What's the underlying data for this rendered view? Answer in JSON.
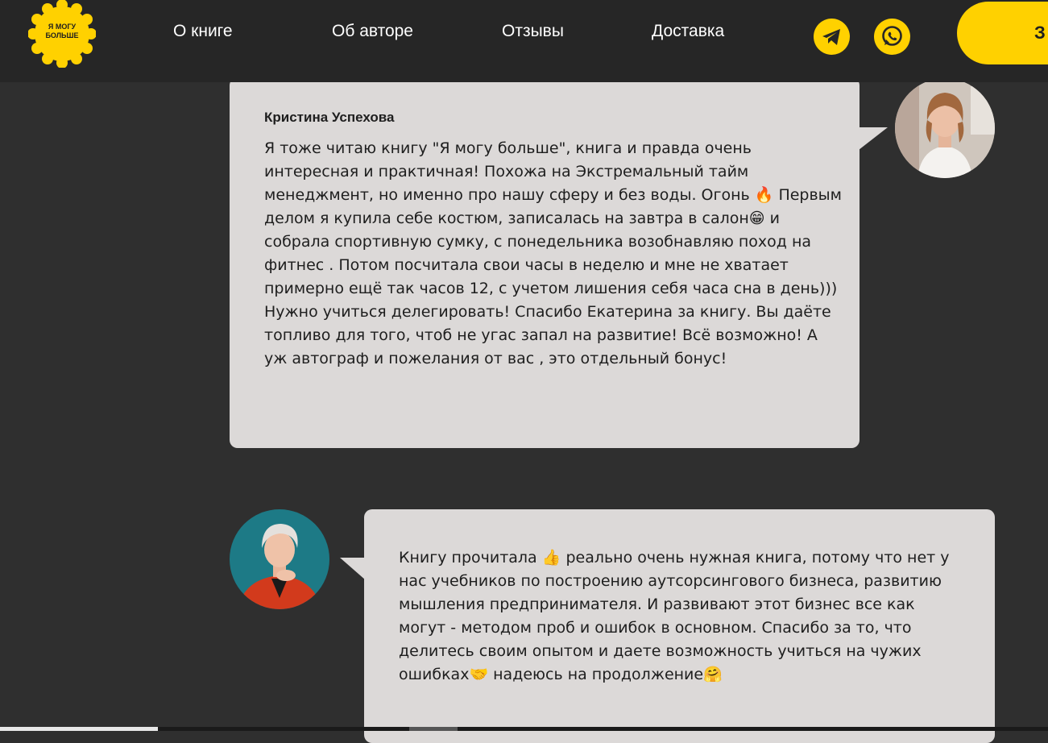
{
  "header": {
    "logo_text": "Я МОГУ\nБОЛЬШЕ",
    "nav": [
      {
        "label": "О книге"
      },
      {
        "label": "Об авторе"
      },
      {
        "label": "Отзывы"
      },
      {
        "label": "Доставка"
      }
    ],
    "social": [
      {
        "icon": "telegram-icon"
      },
      {
        "icon": "whatsapp-icon"
      }
    ],
    "order_button_label": "З"
  },
  "reviews": [
    {
      "author": "Кристина Успехова",
      "text": "Я тоже читаю книгу \"Я могу больше\", книга и правда очень интересная и практичная! Похожа на Экстремальный тайм менеджмент, но именно про нашу сферу и без воды. Огонь 🔥 Первым делом я купила себе костюм, записалась на завтра в салон😁 и собрала спортивную сумку, с понедельника возобнавляю поход на фитнес . Потом посчитала свои часы в неделю и мне не хватает примерно ещё так часов 12, с учетом лишения себя часа сна в день))) Нужно учиться делегировать! Спасибо Екатерина за книгу. Вы даёте топливо для того, чтоб не угас запал на развитие! Всё возможно! А уж автограф и пожелания от вас , это отдельный бонус!",
      "avatar": "reviewer-avatar-icon"
    },
    {
      "author": "",
      "text": "Книгу прочитала 👍 реально очень нужная книга, потому что нет у нас учебников по построению аутсорсингового бизнеса, развитию мышления предпринимателя. И развивают этот бизнес все как могут - методом проб и ошибок в основном. Спасибо за то, что делитесь своим опытом и даете возможность учиться на чужих ошибках🤝 надеюсь на продолжение🤗",
      "avatar": "reviewer-avatar-icon"
    }
  ],
  "colors": {
    "accent": "#ffd100",
    "background": "#2f2f2f",
    "header": "#262626",
    "card": "#dcd9d8",
    "text_dark": "#1e1e1e"
  }
}
